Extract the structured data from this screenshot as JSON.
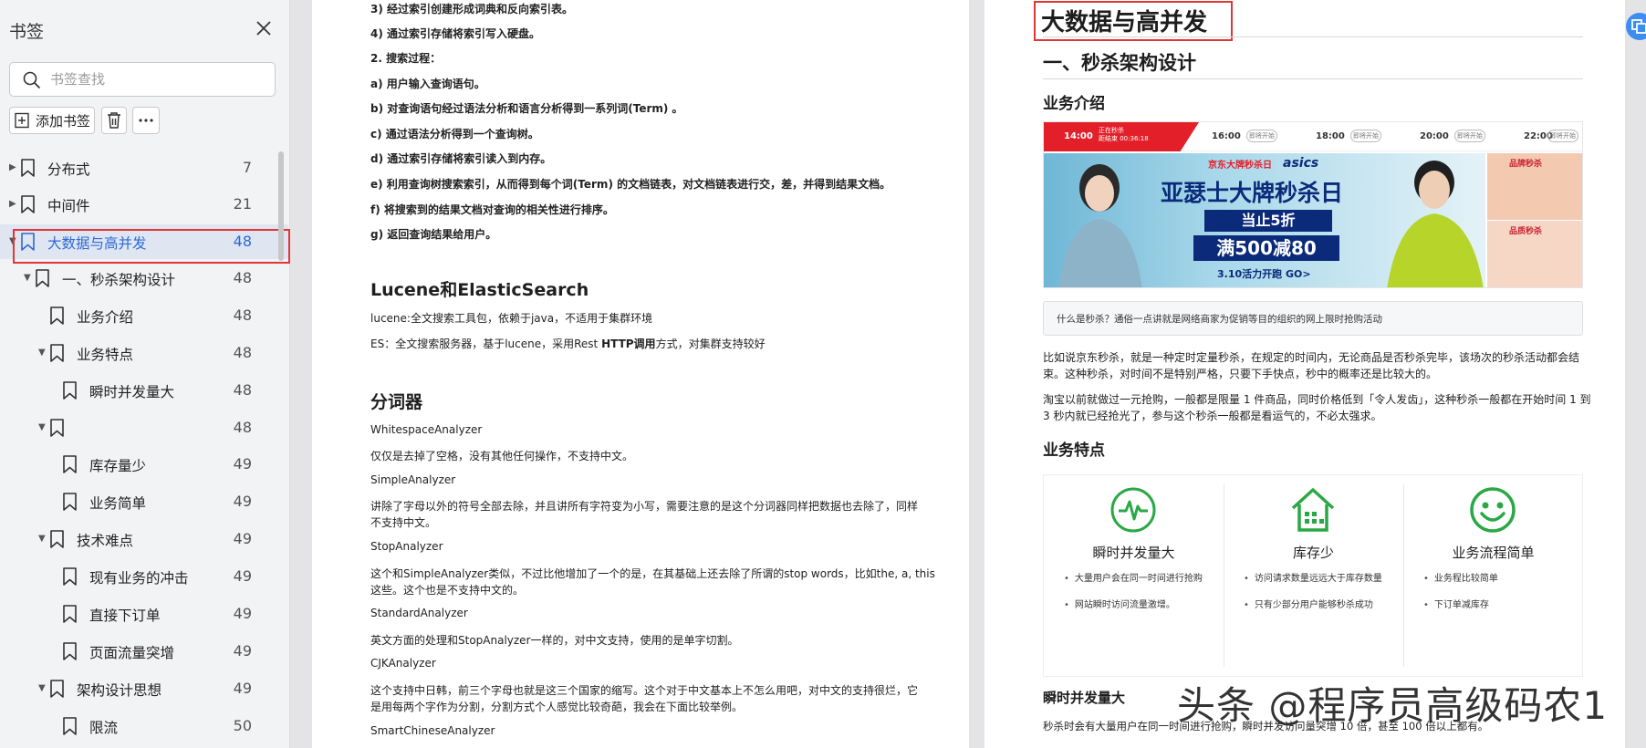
{
  "sidebar": {
    "title": "书签",
    "search_placeholder": "书签查找",
    "add_label": "添加书签",
    "items": [
      {
        "label": "分布式",
        "page": "7"
      },
      {
        "label": "中间件",
        "page": "21"
      },
      {
        "label": "大数据与高并发",
        "page": "48"
      },
      {
        "label": "一、秒杀架构设计",
        "page": "48"
      },
      {
        "label": "业务介绍",
        "page": "48"
      },
      {
        "label": "业务特点",
        "page": "48"
      },
      {
        "label": "瞬时并发量大",
        "page": "48"
      },
      {
        "label": "",
        "page": "48"
      },
      {
        "label": "库存量少",
        "page": "49"
      },
      {
        "label": "业务简单",
        "page": "49"
      },
      {
        "label": "技术难点",
        "page": "49"
      },
      {
        "label": "现有业务的冲击",
        "page": "49"
      },
      {
        "label": "直接下订单",
        "page": "49"
      },
      {
        "label": "页面流量突增",
        "page": "49"
      },
      {
        "label": "架构设计思想",
        "page": "49"
      },
      {
        "label": "限流",
        "page": "50"
      }
    ]
  },
  "page1": {
    "lines": [
      "3) 经过索引创建形成词典和反向索引表。",
      "4) 通过索引存储将索引写入硬盘。",
      "2. 搜索过程：",
      "a) 用户输入查询语句。",
      "b) 对查询语句经过语法分析和语言分析得到一系列词(Term) 。",
      "c) 通过语法分析得到一个查询树。",
      "d) 通过索引存储将索引读入到内存。",
      "e) 利用查询树搜索索引，从而得到每个词(Term) 的文档链表，对文档链表进行交，差，并得到结果文档。",
      "f) 将搜索到的结果文档对查询的相关性进行排序。",
      "g) 返回查询结果给用户。"
    ],
    "heading_lucene": "Lucene和ElasticSearch",
    "lucene_line": "lucene:全文搜索工具包，依赖于java，不适用于集群环境",
    "es_line_a": "ES：全文搜索服务器，基于lucene，采用Rest ",
    "es_line_b": "HTTP调用",
    "es_line_c": "方式，对集群支持较好",
    "heading_analyzer": "分词器",
    "analyzer_lines": [
      "WhitespaceAnalyzer",
      "仅仅是去掉了空格，没有其他任何操作，不支持中文。",
      "SimpleAnalyzer",
      "讲除了字母以外的符号全部去除，并且讲所有字符变为小写，需要注意的是这个分词器同样把数据也去除了，同样",
      "不支持中文。",
      "StopAnalyzer",
      "这个和SimpleAnalyzer类似，不过比他增加了一个的是，在其基础上还去除了所谓的stop words，比如the, a, this",
      "这些。这个也是不支持中文的。",
      "StandardAnalyzer",
      "英文方面的处理和StopAnalyzer一样的，对中文支持，使用的是单字切割。",
      "CJKAnalyzer",
      "这个支持中日韩，前三个字母也就是这三个国家的缩写。这个对于中文基本上不怎么用吧，对中文的支持很烂，它",
      "是用每两个字作为分割，分割方式个人感觉比较奇葩，我会在下面比较举例。",
      "SmartChineseAnalyzer"
    ]
  },
  "page2": {
    "title": "大数据与高并发",
    "h1": "一、秒杀架构设计",
    "h2_intro": "业务介绍",
    "banner": {
      "times": [
        "14:00",
        "16:00",
        "18:00",
        "20:00",
        "22:00"
      ],
      "tab_note_a": "正在秒杀",
      "tab_note_b": "距结束 00:36:18",
      "pill": "即将开始",
      "brand": "京东大牌秒杀日",
      "asics": "asics",
      "headline": "亚瑟士大牌秒杀日",
      "sub1": "当止5折",
      "sub2": "满500减80",
      "sub3": "3.10活力开跑 GO>",
      "side1": "品牌秒杀",
      "side2": "品质秒杀"
    },
    "quote": "什么是秒杀？通俗一点讲就是网络商家为促销等目的组织的网上限时抢购活动",
    "para1a": "比如说京东秒杀，就是一种定时定量秒杀，在规定的时间内，无论商品是否秒杀完毕，该场次的秒杀活动都会结",
    "para1b": "束。这种秒杀，对时间不是特别严格，只要下手快点，秒中的概率还是比较大的。",
    "para2a": "淘宝以前就做过一元抢购，一般都是限量 1 件商品，同时价格低到「令人发齿」，这种秒杀一般都在开始时间 1 到",
    "para2b": "3 秒内就已经抢光了，参与这个秒杀一般都是看运气的，不必太强求。",
    "h2_features": "业务特点",
    "features": [
      {
        "title": "瞬时并发量大",
        "items": [
          "大量用户会在同一时间进行抢购",
          "网站瞬时访问流量激增。"
        ]
      },
      {
        "title": "库存少",
        "items": [
          "访问请求数量远远大于库存数量",
          "只有少部分用户能够秒杀成功"
        ]
      },
      {
        "title": "业务流程简单",
        "items": [
          "业务程比较简单",
          "下订单减库存"
        ]
      }
    ],
    "h2_concurrency": "瞬时并发量大",
    "bottom_line": "秒杀时会有大量用户在同一时间进行抢购，瞬时并发访问量突增 10 倍，甚至 100 倍以上都有。"
  },
  "watermark": "头条 @程序员高级码农1",
  "colors": {
    "accent": "#2d6ad6",
    "highlight": "#e23636",
    "icon_green": "#2aa845"
  }
}
